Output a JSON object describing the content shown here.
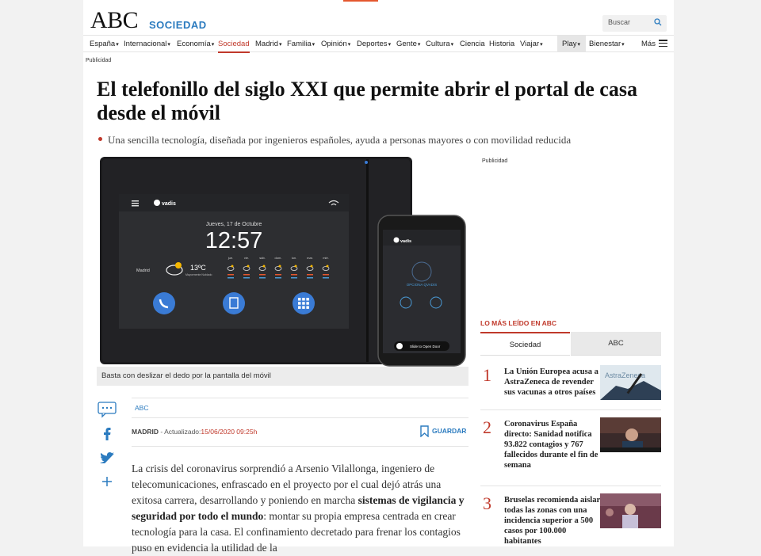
{
  "header": {
    "logo": "ABC",
    "section": "SOCIEDAD",
    "search_placeholder": "Buscar",
    "nav": [
      "España",
      "Internacional",
      "Economía",
      "Sociedad",
      "Madrid",
      "Familia",
      "Opinión",
      "Deportes",
      "Gente",
      "Cultura",
      "Ciencia",
      "Historia",
      "Viajar",
      "Play",
      "Bienestar",
      "Más"
    ],
    "accent": "#c0392b"
  },
  "ad_label": "Publicidad",
  "article": {
    "headline": "El telefonillo del siglo XXI que permite abrir el portal de casa desde el móvil",
    "subhead": "Una sencilla tecnología, diseñada por ingenieros españoles, ayuda a personas mayores o con movilidad reducida",
    "caption": "Basta con deslizar el dedo por la pantalla del móvil",
    "tag": "ABC",
    "location": "MADRID",
    "updated_label": "Actualizado:",
    "date": "15/06/2020 09:25h",
    "save_label": "GUARDAR",
    "body_1": "La crisis del coronavirus sorprendió a Arsenio Vilallonga, ingeniero de telecomunicaciones, enfrascado en el proyecto por el cual dejó atrás una exitosa carrera, desarrollando y poniendo en marcha ",
    "body_bold": "sistemas de vigilancia y seguridad por todo el mundo",
    "body_2": ": montar su propia empresa centrada en crear tecnología para la casa. El confinamiento decretado para frenar los contagios puso en evidencia la utilidad de la"
  },
  "device": {
    "brand": "vadis",
    "date": "Jueves, 17 de Octubre",
    "time": "12:57",
    "city": "Madrid",
    "temp": "13ºC",
    "weather_desc": "Mayormente Nublado",
    "days": [
      "jue.",
      "vie.",
      "sáb.",
      "dom.",
      "lun.",
      "mar.",
      "mié."
    ],
    "phone_open": "OPCIONA QVADIS",
    "slide_label": "Slide to Open Door"
  },
  "sidebar": {
    "title": "LO MÁS LEÍDO EN ABC",
    "tab_1": "Sociedad",
    "tab_2": "ABC",
    "items": [
      {
        "num": "1",
        "text": "La Unión Europea acusa a AstraZeneca de revender sus vacunas a otros países",
        "thumb_text": "AstraZeneca"
      },
      {
        "num": "2",
        "text": "Coronavirus España directo: Sanidad notifica 93.822 contagios y 767 fallecidos durante el fin de semana",
        "thumb_text": ""
      },
      {
        "num": "3",
        "text": "Bruselas recomienda aislar todas las zonas con una incidencia superior a 500 casos por 100.000 habitantes",
        "thumb_text": ""
      }
    ]
  }
}
